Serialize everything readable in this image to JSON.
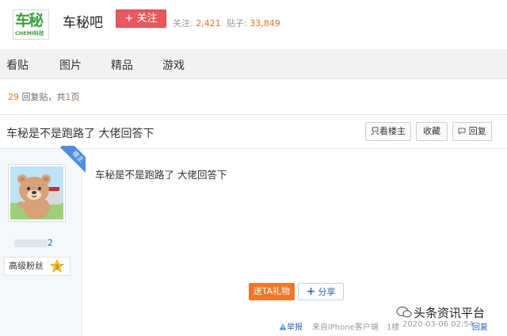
{
  "header": {
    "logo_text": "车秘",
    "logo_subtext": "CHEMI科技",
    "forum_name": "车秘吧",
    "follow_label": "+ 关注",
    "follow_stat_label": "关注:",
    "follow_count": "2,421",
    "post_stat_label": "贴子:",
    "post_count": "33,849"
  },
  "nav": {
    "items": [
      "看贴",
      "图片",
      "精品",
      "游戏"
    ]
  },
  "reply_summary": {
    "count": "29",
    "text1": "回复贴，共",
    "pages": "1",
    "text2": "页"
  },
  "thread": {
    "title": "车秘是不是跑路了 大佬回答下",
    "buttons": {
      "only_op": "只看楼主",
      "favorite": "收藏",
      "reply": "回复"
    }
  },
  "post": {
    "author_tag": "楼主",
    "username_suffix": "2",
    "fan_level_label": "高级粉丝",
    "level": "3",
    "content": "车秘是不是跑路了 大佬回答下",
    "gift_label": "送TA礼物",
    "share_label": "分享",
    "report_label": "举报",
    "source": "来自iPhone客户端",
    "floor": "1楼",
    "timestamp": "2020-03-06 02:54",
    "reply_label": "回复"
  },
  "watermark": {
    "text": "头条资讯平台"
  },
  "colors": {
    "follow_button": "#e9585c",
    "accent_orange": "#e6732e",
    "link_blue": "#2d64b3",
    "logo_green": "#3d9e3d"
  }
}
